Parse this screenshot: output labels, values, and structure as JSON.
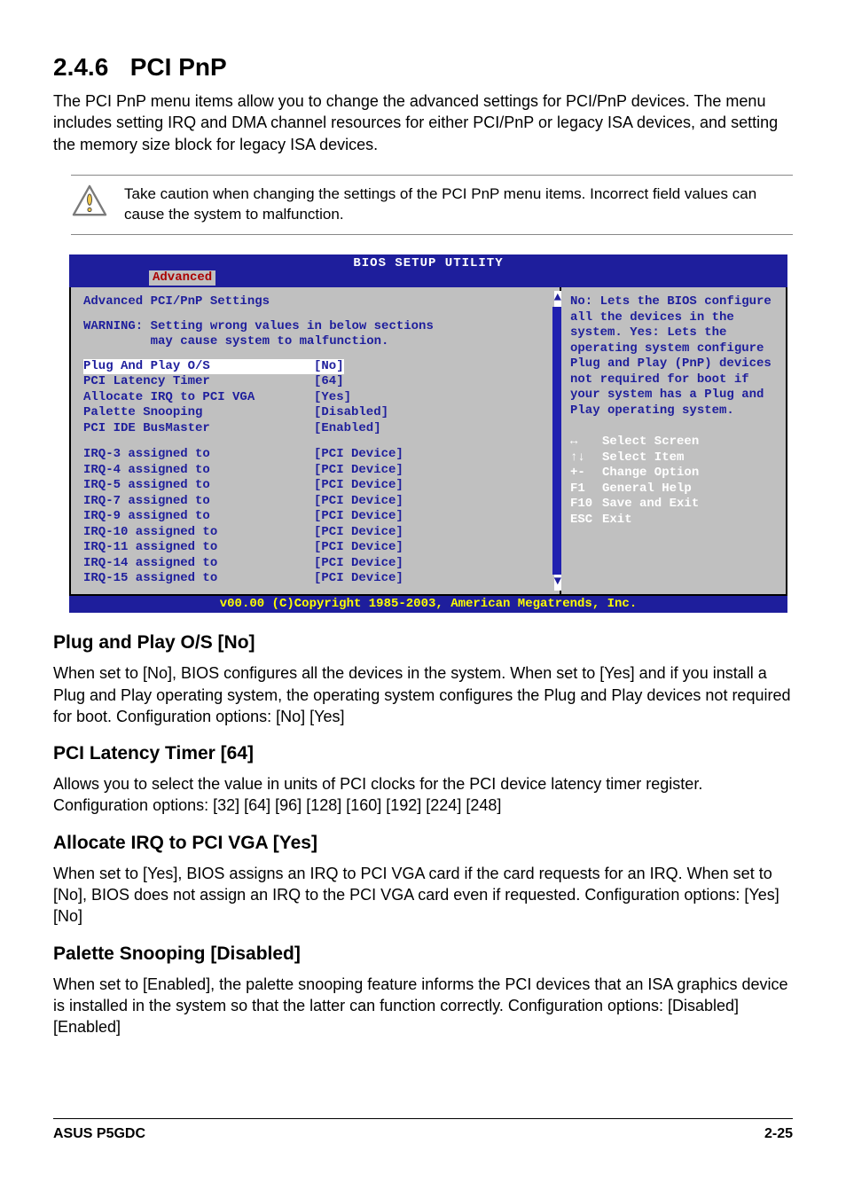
{
  "section": {
    "number": "2.4.6",
    "title": "PCI PnP",
    "intro": "The PCI PnP menu items allow you to change the advanced settings for PCI/PnP devices. The menu includes setting IRQ and DMA channel resources for either PCI/PnP or legacy ISA devices, and setting the memory size block for legacy ISA devices."
  },
  "caution": {
    "text": "Take caution when changing the settings of the PCI PnP menu items. Incorrect field values can cause the system to malfunction."
  },
  "bios": {
    "title": "BIOS SETUP UTILITY",
    "tab": "Advanced",
    "heading": "Advanced PCI/PnP Settings",
    "warning": "WARNING: Setting wrong values in below sections\n         may cause system to malfunction.",
    "items": [
      {
        "label": "Plug And Play O/S",
        "value": "[No]",
        "selected": true
      },
      {
        "label": "PCI Latency Timer",
        "value": "[64]"
      },
      {
        "label": "Allocate IRQ to PCI VGA",
        "value": "[Yes]"
      },
      {
        "label": "Palette Snooping",
        "value": "[Disabled]"
      },
      {
        "label": "PCI IDE BusMaster",
        "value": "[Enabled]"
      }
    ],
    "irq_items": [
      {
        "label": "IRQ-3 assigned to",
        "value": "[PCI Device]"
      },
      {
        "label": "IRQ-4 assigned to",
        "value": "[PCI Device]"
      },
      {
        "label": "IRQ-5 assigned to",
        "value": "[PCI Device]"
      },
      {
        "label": "IRQ-7 assigned to",
        "value": "[PCI Device]"
      },
      {
        "label": "IRQ-9 assigned to",
        "value": "[PCI Device]"
      },
      {
        "label": "IRQ-10 assigned to",
        "value": "[PCI Device]"
      },
      {
        "label": "IRQ-11 assigned to",
        "value": "[PCI Device]"
      },
      {
        "label": "IRQ-14 assigned to",
        "value": "[PCI Device]"
      },
      {
        "label": "IRQ-15 assigned to",
        "value": "[PCI Device]"
      }
    ],
    "help_text": "No: Lets the BIOS configure all the devices in the system. Yes: Lets the operating system configure Plug and Play (PnP) devices not required for boot if your system has a Plug and Play operating system.",
    "keys": [
      {
        "glyph": "↔",
        "label": "Select Screen"
      },
      {
        "glyph": "↑↓",
        "label": "Select Item"
      },
      {
        "glyph": "+-",
        "label": "Change Option"
      },
      {
        "glyph": "F1",
        "label": "General Help"
      },
      {
        "glyph": "F10",
        "label": "Save and Exit"
      },
      {
        "glyph": "ESC",
        "label": "Exit"
      }
    ],
    "footer": "v00.00 (C)Copyright 1985-2003, American Megatrends, Inc."
  },
  "subsections": [
    {
      "heading": "Plug and Play O/S [No]",
      "body": "When set to [No], BIOS configures all the devices in the system. When set to [Yes] and if you install a Plug and Play operating system, the operating system configures the Plug and Play devices not required for boot. Configuration options: [No] [Yes]"
    },
    {
      "heading": "PCI Latency Timer [64]",
      "body": "Allows you to select the value in units of PCI clocks for the PCI device latency timer register. Configuration options: [32] [64] [96] [128] [160] [192] [224] [248]"
    },
    {
      "heading": "Allocate IRQ to PCI VGA [Yes]",
      "body": "When set to [Yes], BIOS assigns an IRQ to PCI VGA card if the card requests for an IRQ. When set to [No], BIOS does not assign an IRQ to the PCI VGA card even if requested. Configuration options: [Yes] [No]"
    },
    {
      "heading": "Palette Snooping [Disabled]",
      "body": "When set to [Enabled], the palette snooping feature informs the PCI devices that an ISA graphics device is installed in the system so that the latter can function correctly. Configuration options: [Disabled] [Enabled]"
    }
  ],
  "footer": {
    "left": "ASUS P5GDC",
    "right": "2-25"
  }
}
